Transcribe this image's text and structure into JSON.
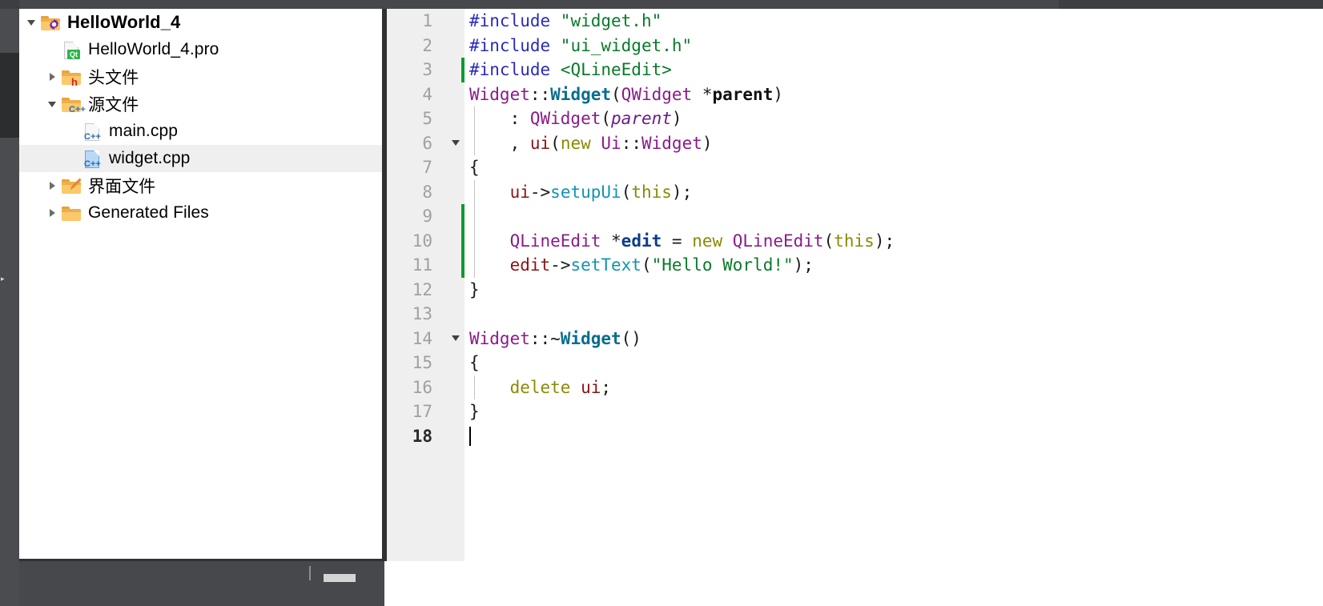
{
  "window": {
    "accent_selected_row": "#efefef",
    "chrome_dark": "#46484c",
    "panel_border": "#2f3133"
  },
  "project_tree": {
    "items": [
      {
        "label": "HelloWorld_4",
        "icon": "folder-project-icon",
        "indent": 0,
        "arrow": "open",
        "bold": true,
        "selected": false
      },
      {
        "label": "HelloWorld_4.pro",
        "icon": "file-qt-pro-icon",
        "indent": 1,
        "arrow": "none",
        "bold": false,
        "selected": false
      },
      {
        "label": "头文件",
        "icon": "folder-headers-icon",
        "indent": 1,
        "arrow": "closed",
        "bold": false,
        "selected": false
      },
      {
        "label": "源文件",
        "icon": "folder-sources-icon",
        "indent": 1,
        "arrow": "open",
        "bold": false,
        "selected": false
      },
      {
        "label": "main.cpp",
        "icon": "file-cpp-icon",
        "indent": 2,
        "arrow": "none",
        "bold": false,
        "selected": false
      },
      {
        "label": "widget.cpp",
        "icon": "file-cpp-active-icon",
        "indent": 2,
        "arrow": "none",
        "bold": false,
        "selected": true
      },
      {
        "label": "界面文件",
        "icon": "folder-forms-icon",
        "indent": 1,
        "arrow": "closed",
        "bold": false,
        "selected": false
      },
      {
        "label": "Generated Files",
        "icon": "folder-plain-icon",
        "indent": 1,
        "arrow": "closed",
        "bold": false,
        "selected": false
      }
    ]
  },
  "editor": {
    "current_line": 18,
    "lines": [
      {
        "n": 1,
        "fold": false,
        "changed": false,
        "indent_guide": false,
        "tokens": [
          {
            "t": "#include ",
            "c": "pre"
          },
          {
            "t": "\"widget.h\"",
            "c": "str"
          }
        ]
      },
      {
        "n": 2,
        "fold": false,
        "changed": false,
        "indent_guide": false,
        "tokens": [
          {
            "t": "#include ",
            "c": "pre"
          },
          {
            "t": "\"ui_widget.h\"",
            "c": "str"
          }
        ]
      },
      {
        "n": 3,
        "fold": false,
        "changed": true,
        "indent_guide": false,
        "tokens": [
          {
            "t": "#include ",
            "c": "pre"
          },
          {
            "t": "<QLineEdit>",
            "c": "str"
          }
        ]
      },
      {
        "n": 4,
        "fold": false,
        "changed": false,
        "indent_guide": false,
        "tokens": [
          {
            "t": "Widget",
            "c": "type"
          },
          {
            "t": "::",
            "c": "plain"
          },
          {
            "t": "Widget",
            "c": "func"
          },
          {
            "t": "(",
            "c": "plain"
          },
          {
            "t": "QWidget",
            "c": "type"
          },
          {
            "t": " *",
            "c": "plain"
          },
          {
            "t": "parent",
            "c": "parb"
          },
          {
            "t": ")",
            "c": "plain"
          }
        ]
      },
      {
        "n": 5,
        "fold": false,
        "changed": false,
        "indent_guide": true,
        "tokens": [
          {
            "t": "    : ",
            "c": "plain"
          },
          {
            "t": "QWidget",
            "c": "type"
          },
          {
            "t": "(",
            "c": "plain"
          },
          {
            "t": "parent",
            "c": "param"
          },
          {
            "t": ")",
            "c": "plain"
          }
        ]
      },
      {
        "n": 6,
        "fold": true,
        "changed": false,
        "indent_guide": true,
        "tokens": [
          {
            "t": "    , ",
            "c": "plain"
          },
          {
            "t": "ui",
            "c": "var"
          },
          {
            "t": "(",
            "c": "plain"
          },
          {
            "t": "new",
            "c": "kw"
          },
          {
            "t": " ",
            "c": "plain"
          },
          {
            "t": "Ui",
            "c": "type"
          },
          {
            "t": "::",
            "c": "plain"
          },
          {
            "t": "Widget",
            "c": "type"
          },
          {
            "t": ")",
            "c": "plain"
          }
        ]
      },
      {
        "n": 7,
        "fold": false,
        "changed": false,
        "indent_guide": false,
        "tokens": [
          {
            "t": "{",
            "c": "plain"
          }
        ]
      },
      {
        "n": 8,
        "fold": false,
        "changed": false,
        "indent_guide": true,
        "tokens": [
          {
            "t": "    ",
            "c": "plain"
          },
          {
            "t": "ui",
            "c": "var"
          },
          {
            "t": "->",
            "c": "plain"
          },
          {
            "t": "setupUi",
            "c": "call"
          },
          {
            "t": "(",
            "c": "plain"
          },
          {
            "t": "this",
            "c": "kw"
          },
          {
            "t": ");",
            "c": "plain"
          }
        ]
      },
      {
        "n": 9,
        "fold": false,
        "changed": true,
        "indent_guide": true,
        "tokens": []
      },
      {
        "n": 10,
        "fold": false,
        "changed": true,
        "indent_guide": true,
        "tokens": [
          {
            "t": "    ",
            "c": "plain"
          },
          {
            "t": "QLineEdit",
            "c": "type"
          },
          {
            "t": " *",
            "c": "plain"
          },
          {
            "t": "edit",
            "c": "varb"
          },
          {
            "t": " = ",
            "c": "plain"
          },
          {
            "t": "new",
            "c": "kw"
          },
          {
            "t": " ",
            "c": "plain"
          },
          {
            "t": "QLineEdit",
            "c": "type"
          },
          {
            "t": "(",
            "c": "plain"
          },
          {
            "t": "this",
            "c": "kw"
          },
          {
            "t": ");",
            "c": "plain"
          }
        ]
      },
      {
        "n": 11,
        "fold": false,
        "changed": true,
        "indent_guide": true,
        "tokens": [
          {
            "t": "    ",
            "c": "plain"
          },
          {
            "t": "edit",
            "c": "var"
          },
          {
            "t": "->",
            "c": "plain"
          },
          {
            "t": "setText",
            "c": "call"
          },
          {
            "t": "(",
            "c": "plain"
          },
          {
            "t": "\"Hello World!\"",
            "c": "str"
          },
          {
            "t": ");",
            "c": "plain"
          }
        ]
      },
      {
        "n": 12,
        "fold": false,
        "changed": false,
        "indent_guide": false,
        "tokens": [
          {
            "t": "}",
            "c": "plain"
          }
        ]
      },
      {
        "n": 13,
        "fold": false,
        "changed": false,
        "indent_guide": false,
        "tokens": []
      },
      {
        "n": 14,
        "fold": true,
        "changed": false,
        "indent_guide": false,
        "tokens": [
          {
            "t": "Widget",
            "c": "type"
          },
          {
            "t": "::~",
            "c": "plain"
          },
          {
            "t": "Widget",
            "c": "func"
          },
          {
            "t": "()",
            "c": "plain"
          }
        ]
      },
      {
        "n": 15,
        "fold": false,
        "changed": false,
        "indent_guide": false,
        "tokens": [
          {
            "t": "{",
            "c": "plain"
          }
        ]
      },
      {
        "n": 16,
        "fold": false,
        "changed": false,
        "indent_guide": true,
        "tokens": [
          {
            "t": "    ",
            "c": "plain"
          },
          {
            "t": "delete",
            "c": "kw"
          },
          {
            "t": " ",
            "c": "plain"
          },
          {
            "t": "ui",
            "c": "var"
          },
          {
            "t": ";",
            "c": "plain"
          }
        ]
      },
      {
        "n": 17,
        "fold": false,
        "changed": false,
        "indent_guide": false,
        "tokens": [
          {
            "t": "}",
            "c": "plain"
          }
        ]
      },
      {
        "n": 18,
        "fold": false,
        "changed": false,
        "indent_guide": false,
        "tokens": [],
        "cursor": true
      }
    ],
    "token_colors": {
      "pre": "#2b2bbb",
      "str": "#0a7a2a",
      "type": "#8a1b8a",
      "func": "#0b6e8c",
      "call": "#1194b0",
      "kw": "#8a8a06",
      "var": "#8a1414",
      "varb": "#0b3c8c",
      "param": "#6a1b8a",
      "parb": "#111111",
      "plain": "#1a1a1a"
    },
    "change_marker_color": "#0a9b2c"
  }
}
